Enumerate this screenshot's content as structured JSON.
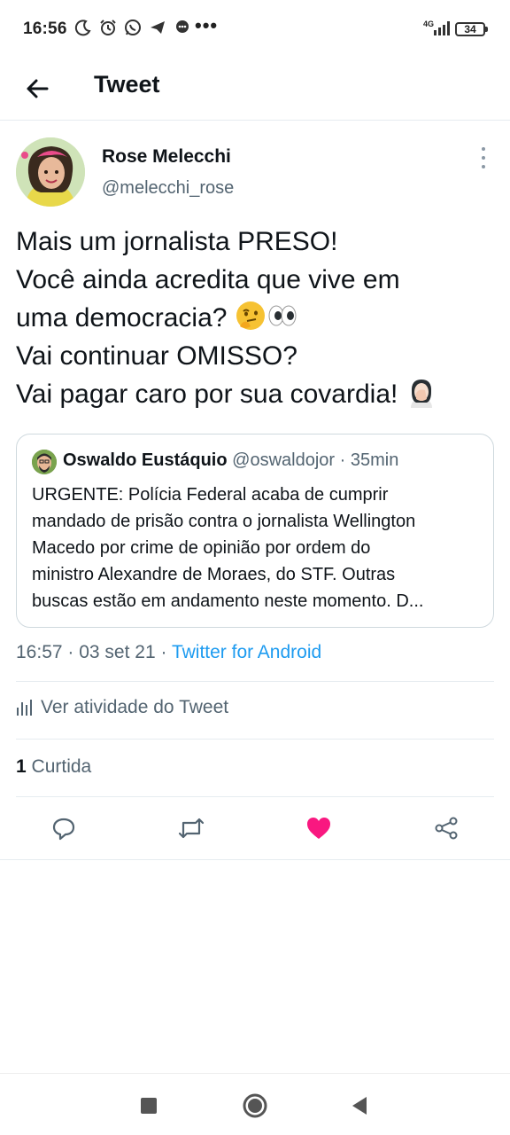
{
  "status_bar": {
    "time": "16:56",
    "more": "•••",
    "network": "4G",
    "battery": "34"
  },
  "header": {
    "title": "Tweet"
  },
  "author": {
    "name": "Rose Melecchi",
    "handle": "@melecchi_rose"
  },
  "tweet": {
    "lines": [
      "Mais um jornalista PRESO!",
      "Você ainda acredita que vive em",
      "uma democracia? ",
      "Vai continuar OMISSO?",
      "Vai pagar caro por sua covardia! "
    ]
  },
  "quote": {
    "name": "Oswaldo Eustáquio",
    "handle": "@oswaldojor",
    "separator": " · ",
    "time": "35min",
    "lines": [
      "URGENTE: Polícia Federal acaba de cumprir",
      "mandado de prisão contra o jornalista Wellington",
      "Macedo por crime de opinião por ordem do",
      "ministro Alexandre de Moraes, do STF. Outras",
      "buscas estão em andamento neste momento. D..."
    ]
  },
  "meta": {
    "time": "16:57",
    "separator": " · ",
    "date": "03 set 21",
    "source": "Twitter for Android"
  },
  "activity": {
    "label": "Ver atividade do Tweet"
  },
  "likes": {
    "count": "1",
    "label": " Curtida"
  },
  "colors": {
    "accent": "#1d9bf0",
    "like": "#f91880",
    "secondary_text": "#536471"
  },
  "icons": {
    "back": "arrow-left-icon",
    "reply": "reply-icon",
    "retweet": "retweet-icon",
    "like": "heart-filled-icon",
    "share": "share-icon"
  }
}
